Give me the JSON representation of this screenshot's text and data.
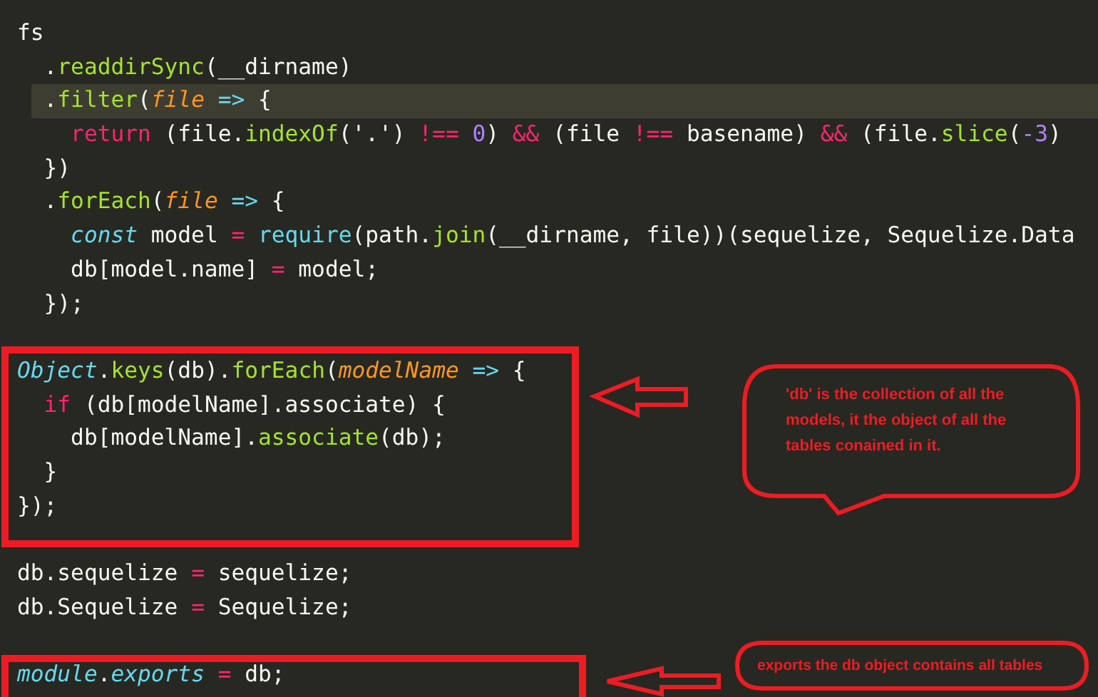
{
  "editor": {
    "lines": [
      {
        "kind": "code",
        "highlighted": false,
        "tokens": [
          {
            "kind": "plain",
            "t": "fs"
          }
        ]
      },
      {
        "kind": "code",
        "highlighted": false,
        "tokens": [
          {
            "kind": "plain",
            "t": "  ."
          },
          {
            "kind": "fn",
            "t": "readdirSync"
          },
          {
            "kind": "plain",
            "t": "(__dirname)"
          }
        ]
      },
      {
        "kind": "code",
        "highlighted": true,
        "tokens": [
          {
            "kind": "plain",
            "t": "  ."
          },
          {
            "kind": "fn",
            "t": "filter"
          },
          {
            "kind": "plain",
            "t": "("
          },
          {
            "kind": "param",
            "t": "file"
          },
          {
            "kind": "op",
            "t": " =>"
          },
          {
            "kind": "plain",
            "t": " {"
          }
        ]
      },
      {
        "kind": "code",
        "highlighted": false,
        "tokens": [
          {
            "kind": "kw",
            "t": "    return"
          },
          {
            "kind": "plain",
            "t": " (file."
          },
          {
            "kind": "fn",
            "t": "indexOf"
          },
          {
            "kind": "plain",
            "t": "('.') "
          },
          {
            "kind": "kw",
            "t": "!=="
          },
          {
            "kind": "num",
            "t": " 0"
          },
          {
            "kind": "plain",
            "t": ") "
          },
          {
            "kind": "kw",
            "t": "&&"
          },
          {
            "kind": "plain",
            "t": " (file "
          },
          {
            "kind": "kw",
            "t": "!=="
          },
          {
            "kind": "plain",
            "t": " basename) "
          },
          {
            "kind": "kw",
            "t": "&&"
          },
          {
            "kind": "plain",
            "t": " (file."
          },
          {
            "kind": "fn",
            "t": "slice"
          },
          {
            "kind": "plain",
            "t": "("
          },
          {
            "kind": "num",
            "t": "-3"
          },
          {
            "kind": "plain",
            "t": ")"
          }
        ]
      },
      {
        "kind": "code",
        "highlighted": false,
        "tokens": [
          {
            "kind": "plain",
            "t": "  })"
          }
        ]
      },
      {
        "kind": "code",
        "highlighted": false,
        "tokens": [
          {
            "kind": "plain",
            "t": "  ."
          },
          {
            "kind": "fn",
            "t": "forEach"
          },
          {
            "kind": "plain",
            "t": "("
          },
          {
            "kind": "param",
            "t": "file"
          },
          {
            "kind": "op",
            "t": " =>"
          },
          {
            "kind": "plain",
            "t": " {"
          }
        ]
      },
      {
        "kind": "code",
        "highlighted": false,
        "tokens": [
          {
            "kind": "storage",
            "t": "    const"
          },
          {
            "kind": "plain",
            "t": " model "
          },
          {
            "kind": "kw",
            "t": "="
          },
          {
            "kind": "op",
            "t": " require"
          },
          {
            "kind": "plain",
            "t": "(path."
          },
          {
            "kind": "fn",
            "t": "join"
          },
          {
            "kind": "plain",
            "t": "(__dirname, file))(sequelize, Sequelize.Data"
          }
        ]
      },
      {
        "kind": "code",
        "highlighted": false,
        "tokens": [
          {
            "kind": "plain",
            "t": "    db[model.name] "
          },
          {
            "kind": "kw",
            "t": "="
          },
          {
            "kind": "plain",
            "t": " model;"
          }
        ]
      },
      {
        "kind": "code",
        "highlighted": false,
        "tokens": [
          {
            "kind": "plain",
            "t": "  });"
          }
        ]
      },
      {
        "kind": "blank"
      },
      {
        "kind": "code",
        "highlighted": false,
        "tokens": [
          {
            "kind": "storage",
            "t": "Object"
          },
          {
            "kind": "plain",
            "t": "."
          },
          {
            "kind": "fn",
            "t": "keys"
          },
          {
            "kind": "plain",
            "t": "(db)."
          },
          {
            "kind": "fn",
            "t": "forEach"
          },
          {
            "kind": "plain",
            "t": "("
          },
          {
            "kind": "param",
            "t": "modelName"
          },
          {
            "kind": "op",
            "t": " =>"
          },
          {
            "kind": "plain",
            "t": " {"
          }
        ]
      },
      {
        "kind": "code",
        "highlighted": false,
        "tokens": [
          {
            "kind": "kw",
            "t": "  if"
          },
          {
            "kind": "plain",
            "t": " (db[modelName].associate) {"
          }
        ]
      },
      {
        "kind": "code",
        "highlighted": false,
        "tokens": [
          {
            "kind": "plain",
            "t": "    db[modelName]."
          },
          {
            "kind": "fn",
            "t": "associate"
          },
          {
            "kind": "plain",
            "t": "(db);"
          }
        ]
      },
      {
        "kind": "code",
        "highlighted": false,
        "tokens": [
          {
            "kind": "plain",
            "t": "  }"
          }
        ]
      },
      {
        "kind": "code",
        "highlighted": false,
        "tokens": [
          {
            "kind": "plain",
            "t": "});"
          }
        ]
      },
      {
        "kind": "blank"
      },
      {
        "kind": "code",
        "highlighted": false,
        "tokens": [
          {
            "kind": "plain",
            "t": "db.sequelize "
          },
          {
            "kind": "kw",
            "t": "="
          },
          {
            "kind": "plain",
            "t": " sequelize;"
          }
        ]
      },
      {
        "kind": "code",
        "highlighted": false,
        "tokens": [
          {
            "kind": "plain",
            "t": "db.Sequelize "
          },
          {
            "kind": "kw",
            "t": "="
          },
          {
            "kind": "plain",
            "t": " Sequelize;"
          }
        ]
      },
      {
        "kind": "blank"
      },
      {
        "kind": "code",
        "highlighted": false,
        "tokens": [
          {
            "kind": "storage",
            "t": "module"
          },
          {
            "kind": "plain",
            "t": "."
          },
          {
            "kind": "storage",
            "t": "exports"
          },
          {
            "kind": "kw",
            "t": " ="
          },
          {
            "kind": "plain",
            "t": " db;"
          }
        ]
      }
    ]
  },
  "callouts": [
    {
      "text": "'db' is the collection of all the models, it the object of all the tables conained in it."
    },
    {
      "text": "exports the db object contains all tables"
    }
  ]
}
